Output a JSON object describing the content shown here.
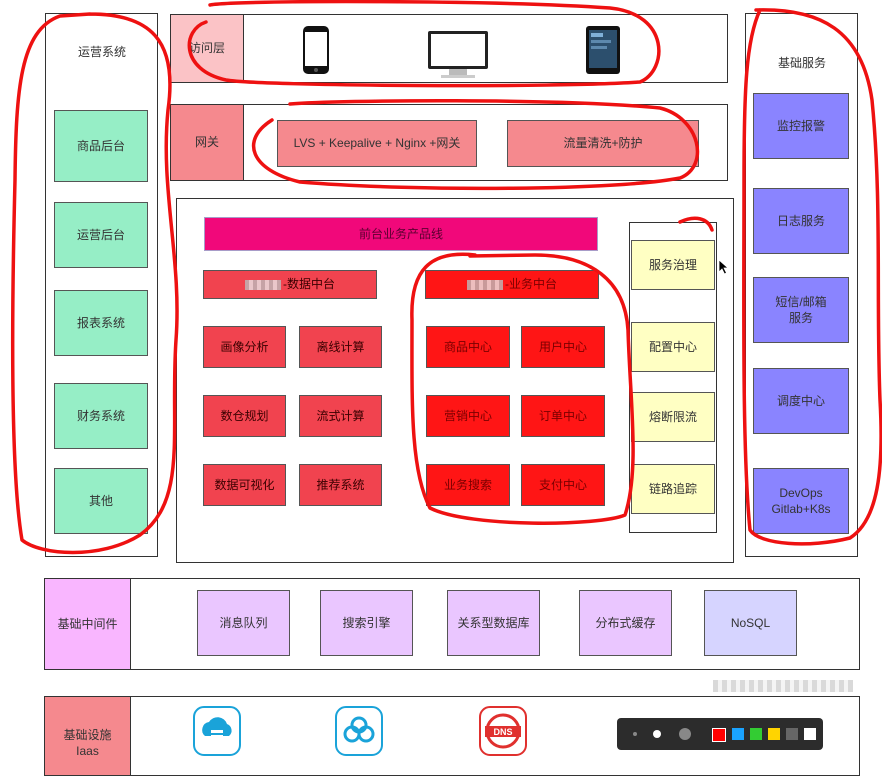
{
  "left": {
    "title": "运营系统",
    "items": [
      "商品后台",
      "运营后台",
      "报表系统",
      "财务系统",
      "其他"
    ]
  },
  "access": {
    "label": "访问层",
    "devices": [
      "phone-icon",
      "monitor-icon",
      "tablet-icon"
    ]
  },
  "gateway": {
    "label": "网关",
    "items": [
      "LVS + Keepalive + Nginx +网关",
      "流量清洗+防护"
    ]
  },
  "frontline": {
    "label": "前台业务产品线"
  },
  "data_platform": {
    "title": "-数据中台",
    "items": [
      "画像分析",
      "离线计算",
      "数仓规划",
      "流式计算",
      "数据可视化",
      "推荐系统"
    ]
  },
  "biz_platform": {
    "title": "-业务中台",
    "items": [
      "商品中心",
      "用户中心",
      "营销中心",
      "订单中心",
      "业务搜索",
      "支付中心"
    ]
  },
  "governance": {
    "items": [
      "服务治理",
      "配置中心",
      "熔断限流",
      "链路追踪"
    ]
  },
  "right": {
    "title": "基础服务",
    "items": [
      "监控报警",
      "日志服务",
      "短信/邮箱服务",
      "调度中心",
      "DevOps Gitlab+K8s"
    ]
  },
  "middleware": {
    "label": "基础中间件",
    "items": [
      "消息队列",
      "搜索引擎",
      "关系型数据库",
      "分布式缓存",
      "NoSQL"
    ]
  },
  "infra": {
    "label": "基础设施 Iaas",
    "icons": [
      "cloud-storage-icon",
      "cloud-network-icon",
      "dns-icon"
    ]
  },
  "toolbar": {
    "colors": [
      "#ff0000",
      "#1aa3ff",
      "#33cc33",
      "#ffd400",
      "#666666",
      "#ffffff"
    ]
  }
}
